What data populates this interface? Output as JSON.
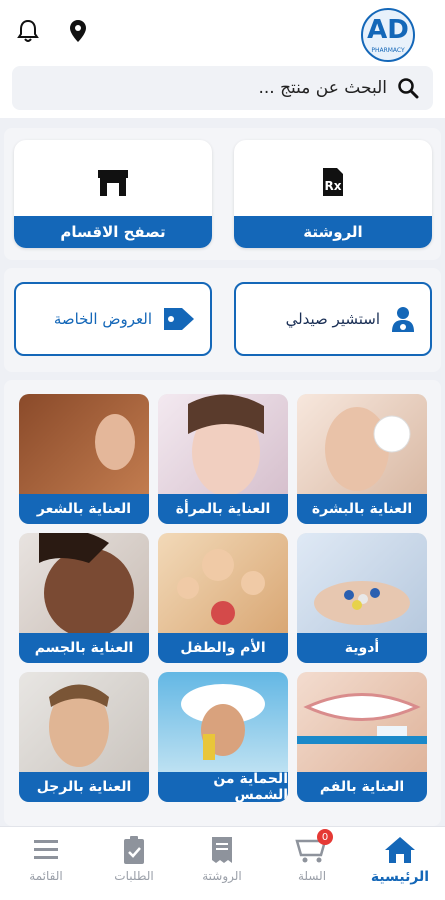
{
  "header": {
    "logo_text": "AD",
    "logo_sub": "PHARMACY",
    "search_placeholder": "البحث عن منتج ..."
  },
  "quick_actions": [
    {
      "label": "الروشتة",
      "icon": "prescription-icon"
    },
    {
      "label": "تصفح الاقسام",
      "icon": "store-icon"
    }
  ],
  "services": [
    {
      "label": "استشير صيدلي",
      "icon": "pharmacist-icon"
    },
    {
      "label": "العروض الخاصة",
      "icon": "tag-icon"
    }
  ],
  "categories": [
    {
      "label": "العناية بالبشرة"
    },
    {
      "label": "العناية بالمرأة"
    },
    {
      "label": "العناية بالشعر"
    },
    {
      "label": "أدوية"
    },
    {
      "label": "الأم والطفل"
    },
    {
      "label": "العناية بالجسم"
    },
    {
      "label": "العناية بالفم"
    },
    {
      "label": "الحماية من الشمس"
    },
    {
      "label": "العناية بالرجل"
    }
  ],
  "bottom_nav": [
    {
      "label": "الرئيسية",
      "icon": "home-icon",
      "active": true
    },
    {
      "label": "السلة",
      "icon": "cart-icon",
      "badge": "0"
    },
    {
      "label": "الروشتة",
      "icon": "receipt-icon"
    },
    {
      "label": "الطلبات",
      "icon": "clipboard-check-icon"
    },
    {
      "label": "القائمة",
      "icon": "menu-icon"
    }
  ],
  "colors": {
    "primary": "#1467b8",
    "background": "#eef0f5"
  }
}
